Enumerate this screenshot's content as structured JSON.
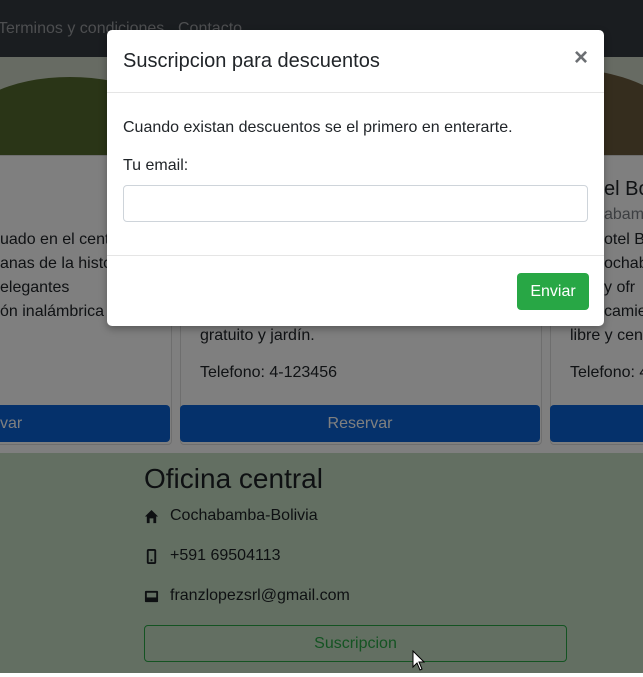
{
  "navbar": {
    "links": [
      "Terminos y condiciones",
      "Contacto"
    ]
  },
  "cards": [
    {
      "title": "",
      "subtitle": "",
      "lines": [
        "uado en el centr",
        "anas de la histo",
        "elegantes",
        "ón inalámbrica"
      ],
      "phone": "",
      "button": "var"
    },
    {
      "title": "",
      "subtitle": "",
      "lines": [
        "gratuito y jardín."
      ],
      "phone": "Telefono: 4-123456",
      "button": "Reservar"
    },
    {
      "title": "el Bo",
      "subtitle": "abam",
      "lines": [
        "otel Bo",
        "ochab",
        "y ofr",
        "camie",
        "libre y cen"
      ],
      "phone": "Telefono: 4",
      "button": ""
    }
  ],
  "office": {
    "title": "Oficina central",
    "location": "Cochabamba-Bolivia",
    "phone": "+591 69504113",
    "email": "franzlopezsrl@gmail.com",
    "subscribe_button": "Suscripcion"
  },
  "modal": {
    "title": "Suscripcion para descuentos",
    "close": "×",
    "text": "Cuando existan descuentos se el primero en enterarte.",
    "label": "Tu email:",
    "email_value": "",
    "email_placeholder": "",
    "send_button": "Enviar"
  },
  "colors": {
    "primary": "#007bff",
    "success": "#28a745",
    "navbar": "#343a40",
    "footer": "#c6dfc4"
  }
}
